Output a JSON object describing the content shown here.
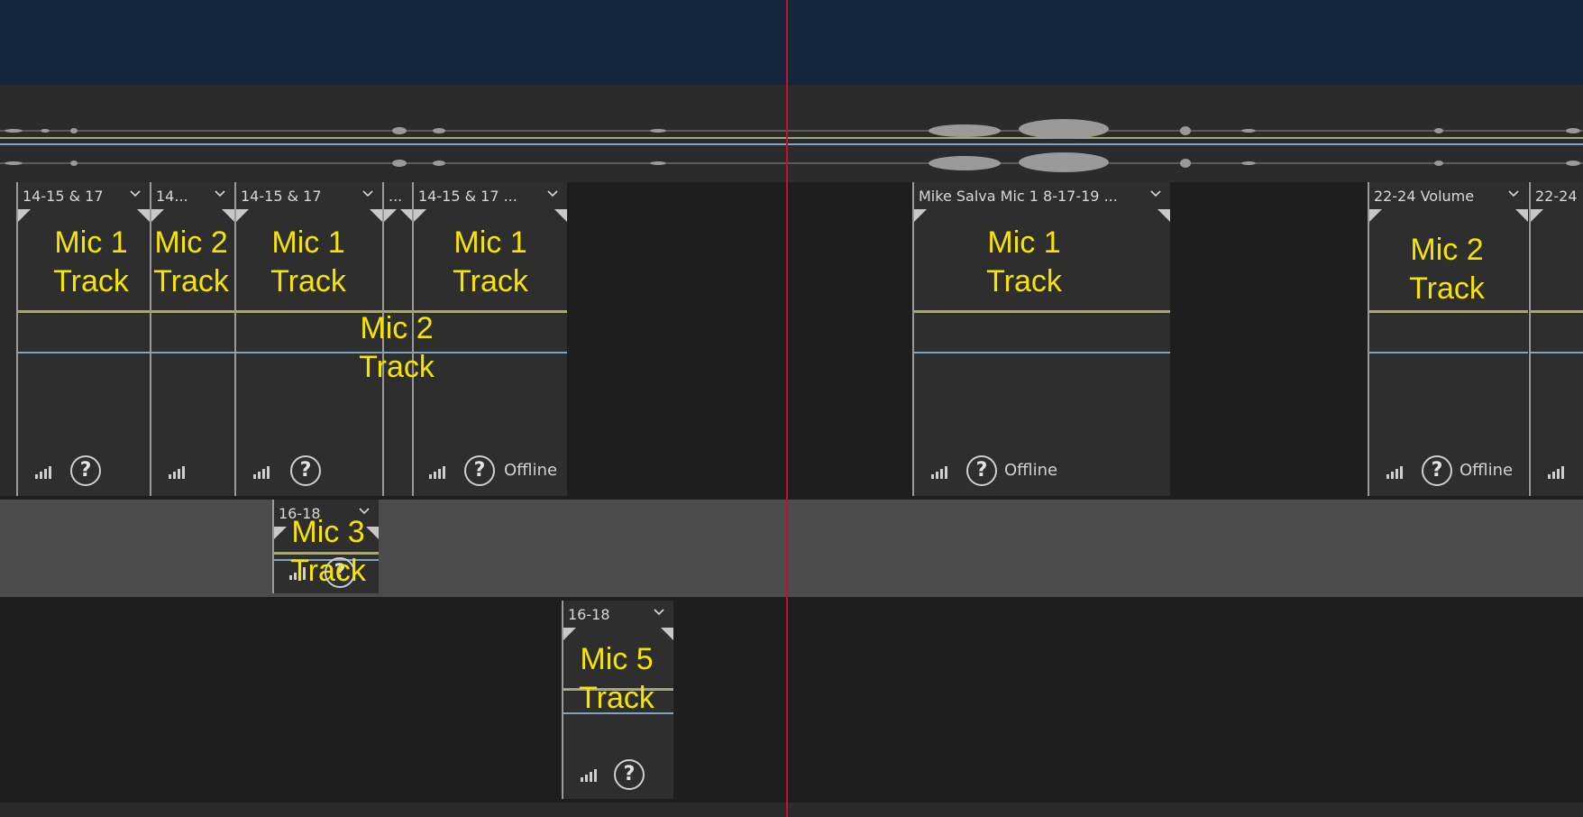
{
  "clips": {
    "c1_title": "14-15 & 17",
    "c2_title": "14...",
    "c3_title": "14-15 & 17",
    "c4_title": "...",
    "c5_title": "14-15 & 17 ...",
    "c6_title": "Mike Salva Mic 1 8-17-19 ...",
    "c7_title": "22-24  Volume",
    "c8_title": "22-24",
    "c9_title": "16-18",
    "c10_title": "16-18"
  },
  "labels": {
    "mic1": "Mic 1",
    "mic2": "Mic 2",
    "mic3": "Mic 3",
    "mic5": "Mic 5",
    "track": "Track"
  },
  "status": {
    "offline": "Offline",
    "question": "?"
  },
  "icons": [
    "chevron-down-icon",
    "signal-bars-icon",
    "question-icon"
  ],
  "colors": {
    "label_yellow": "#f5e400",
    "playhead_red": "#c8102e",
    "volume_line": "#a9a57a",
    "pan_line": "#7ea4c2"
  }
}
